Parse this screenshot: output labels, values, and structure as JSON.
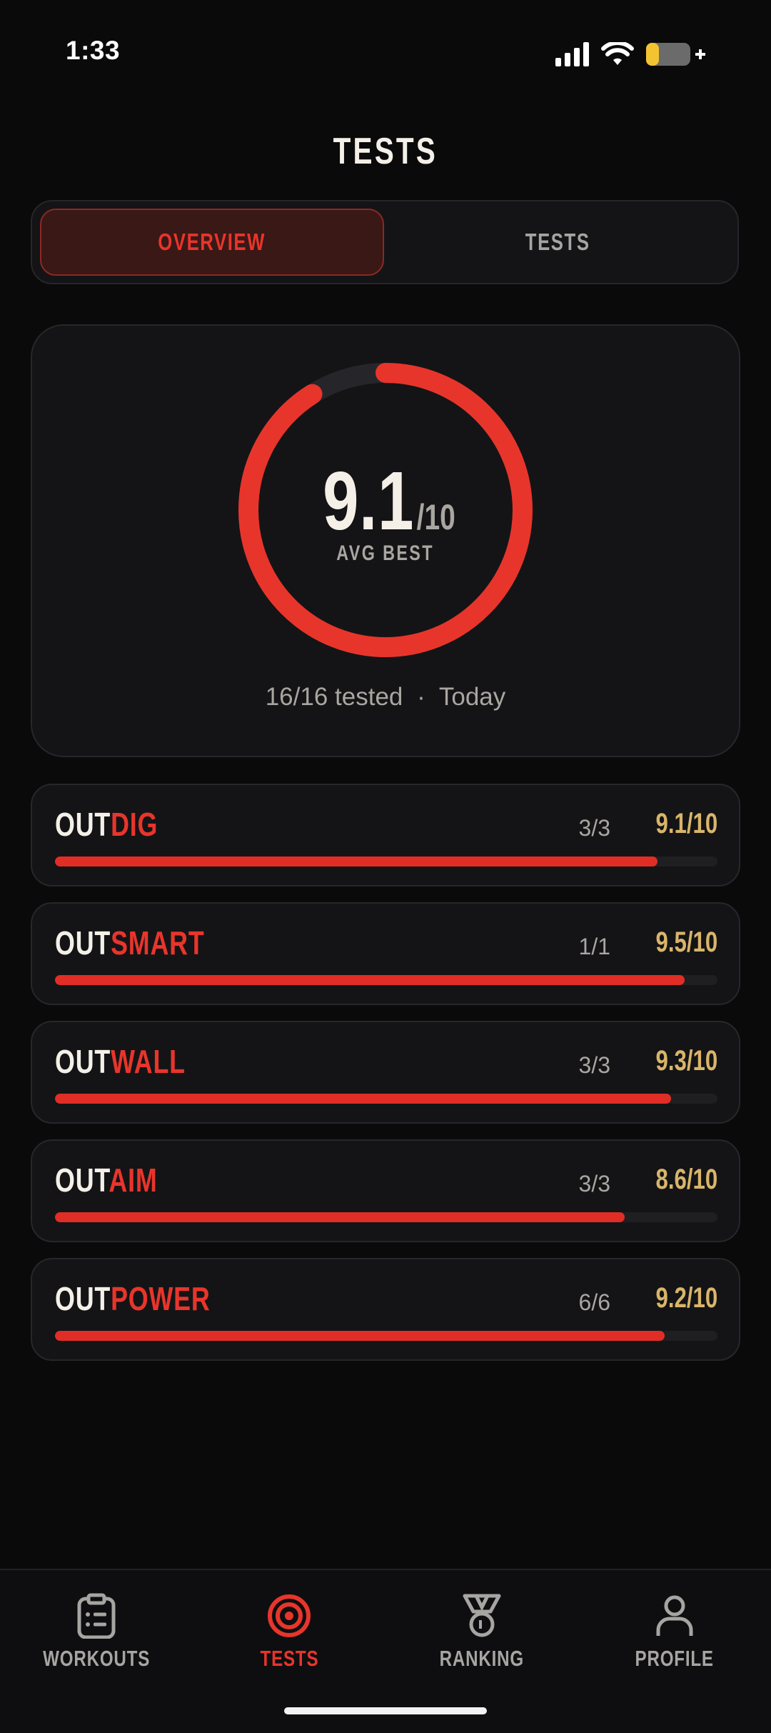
{
  "status_bar": {
    "time": "1:33"
  },
  "header": {
    "title": "TESTS"
  },
  "segmented": {
    "overview": "OVERVIEW",
    "tests": "TESTS",
    "selected": "OVERVIEW"
  },
  "overview": {
    "score": "9.1",
    "score_suffix": "/10",
    "score_value": 9.1,
    "score_max": 10,
    "label": "AVG BEST",
    "tested": "16/16 tested",
    "separator": "·",
    "when": "Today"
  },
  "categories": [
    {
      "prefix": "OUT",
      "suffix": "DIG",
      "count": "3/3",
      "score": "9.1/10",
      "value": 9.1
    },
    {
      "prefix": "OUT",
      "suffix": "SMART",
      "count": "1/1",
      "score": "9.5/10",
      "value": 9.5
    },
    {
      "prefix": "OUT",
      "suffix": "WALL",
      "count": "3/3",
      "score": "9.3/10",
      "value": 9.3
    },
    {
      "prefix": "OUT",
      "suffix": "AIM",
      "count": "3/3",
      "score": "8.6/10",
      "value": 8.6
    },
    {
      "prefix": "OUT",
      "suffix": "POWER",
      "count": "6/6",
      "score": "9.2/10",
      "value": 9.2
    }
  ],
  "tabbar": {
    "items": [
      {
        "label": "WORKOUTS",
        "icon": "clipboard-icon",
        "active": false
      },
      {
        "label": "TESTS",
        "icon": "target-icon",
        "active": true
      },
      {
        "label": "RANKING",
        "icon": "medal-icon",
        "active": false
      },
      {
        "label": "PROFILE",
        "icon": "person-icon",
        "active": false
      }
    ]
  },
  "colors": {
    "accent": "#e8352b",
    "gold": "#d9b56a",
    "background": "#0a0a0b",
    "card": "#141416",
    "muted": "#a9a6a1"
  }
}
